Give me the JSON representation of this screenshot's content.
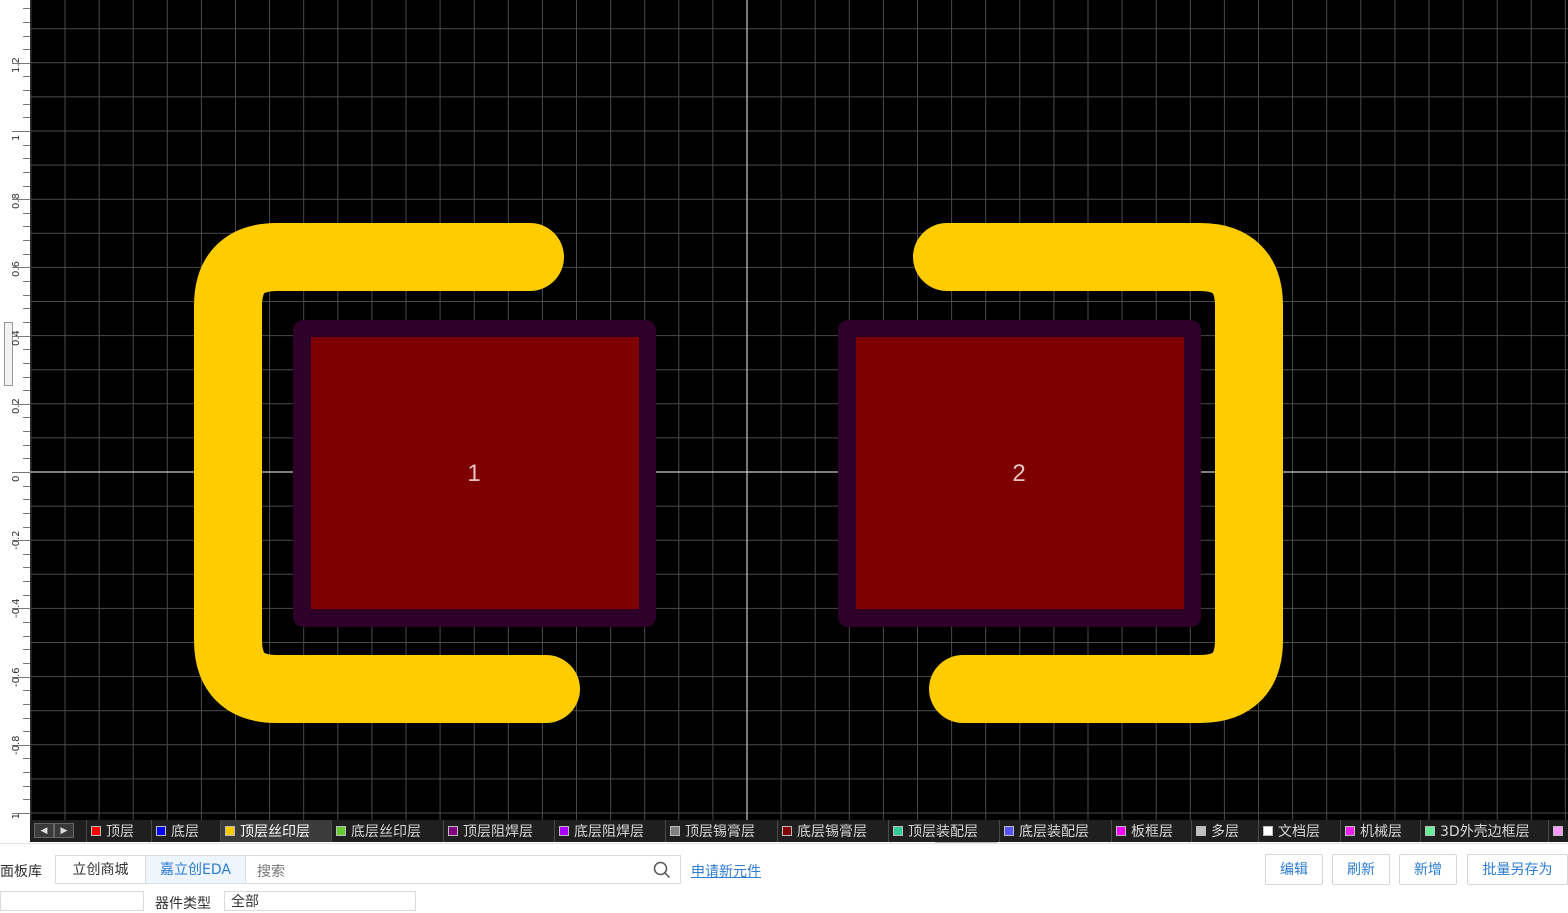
{
  "ruler": {
    "labels": [
      "1.2",
      "1",
      "0.8",
      "0.6",
      "0.4",
      "0.2",
      "0",
      "-0.2",
      "-0.4",
      "-0.6",
      "-0.8",
      "-1"
    ]
  },
  "canvas": {
    "pads": [
      {
        "number": "1"
      },
      {
        "number": "2"
      }
    ],
    "colors": {
      "background": "#000000",
      "grid": "#4a4a4a",
      "axis": "#c8c8c8",
      "silkscreen": "#ffcc00",
      "pad": "#7f0000",
      "solder_mask": "#2e0029",
      "pad_label": "#e6c3c3"
    }
  },
  "layer_bar": {
    "tabs": [
      {
        "label": "顶层",
        "color": "#ff0000"
      },
      {
        "label": "底层",
        "color": "#0000ff"
      },
      {
        "label": "顶层丝印层",
        "color": "#ffcc00",
        "active": true
      },
      {
        "label": "底层丝印层",
        "color": "#66cc33"
      },
      {
        "label": "顶层阻焊层",
        "color": "#800080"
      },
      {
        "label": "底层阻焊层",
        "color": "#aa00ff"
      },
      {
        "label": "顶层锡膏层",
        "color": "#808080"
      },
      {
        "label": "底层锡膏层",
        "color": "#800000"
      },
      {
        "label": "顶层装配层",
        "color": "#33cc99"
      },
      {
        "label": "底层装配层",
        "color": "#5555ff"
      },
      {
        "label": "板框层",
        "color": "#ff00ff"
      },
      {
        "label": "多层",
        "color": "#c0c0c0"
      },
      {
        "label": "文档层",
        "color": "#ffffff"
      },
      {
        "label": "机械层",
        "color": "#f022f0"
      },
      {
        "label": "3D外壳边框层",
        "color": "#66ee99"
      },
      {
        "label": "",
        "color": "#ff99ff"
      }
    ]
  },
  "bottom_panel": {
    "title": "面板库",
    "tabs": [
      {
        "label": "立创商城",
        "active": false
      },
      {
        "label": "嘉立创EDA",
        "active": true
      }
    ],
    "search_placeholder": "搜索",
    "apply_link": "申请新元件",
    "buttons": {
      "edit": "编辑",
      "refresh": "刷新",
      "add": "新增",
      "batch_save": "批量另存为"
    },
    "device_type_label": "器件类型",
    "device_type_value": "全部"
  }
}
